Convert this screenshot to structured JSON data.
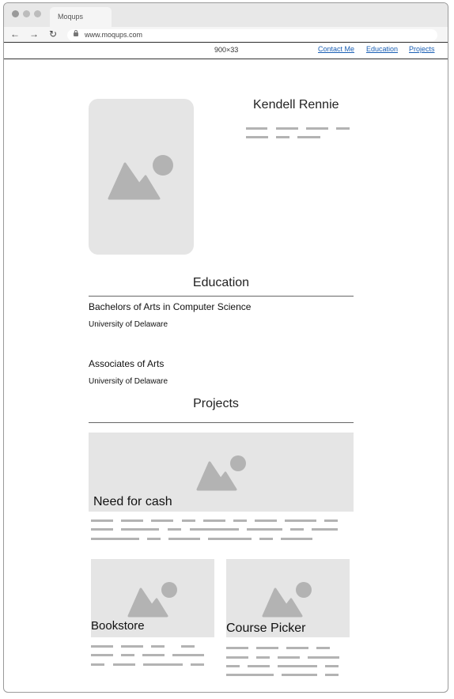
{
  "browser": {
    "tab_title": "Moqups",
    "url": "www.moqups.com",
    "back_icon": "arrow-left-icon",
    "forward_icon": "arrow-right-icon",
    "reload_icon": "reload-icon"
  },
  "header": {
    "dimensions": "900×33",
    "links": [
      "Contact Me",
      "Education",
      "Projects"
    ]
  },
  "profile": {
    "name": "Kendell Rennie",
    "photo_icon": "image-placeholder-icon"
  },
  "education": {
    "title": "Education",
    "entries": [
      {
        "degree": "Bachelors of Arts in Computer Science",
        "school": "University of Delaware"
      },
      {
        "degree": "Associates of Arts",
        "school": "University of Delaware"
      }
    ]
  },
  "projects": {
    "title": "Projects",
    "items": [
      {
        "name": "Need for cash"
      },
      {
        "name": "Bookstore"
      },
      {
        "name": "Course Picker"
      }
    ]
  },
  "colors": {
    "placeholder_bg": "#e5e5e5",
    "placeholder_icon": "#b3b3b3",
    "link": "#1a5fb4"
  }
}
